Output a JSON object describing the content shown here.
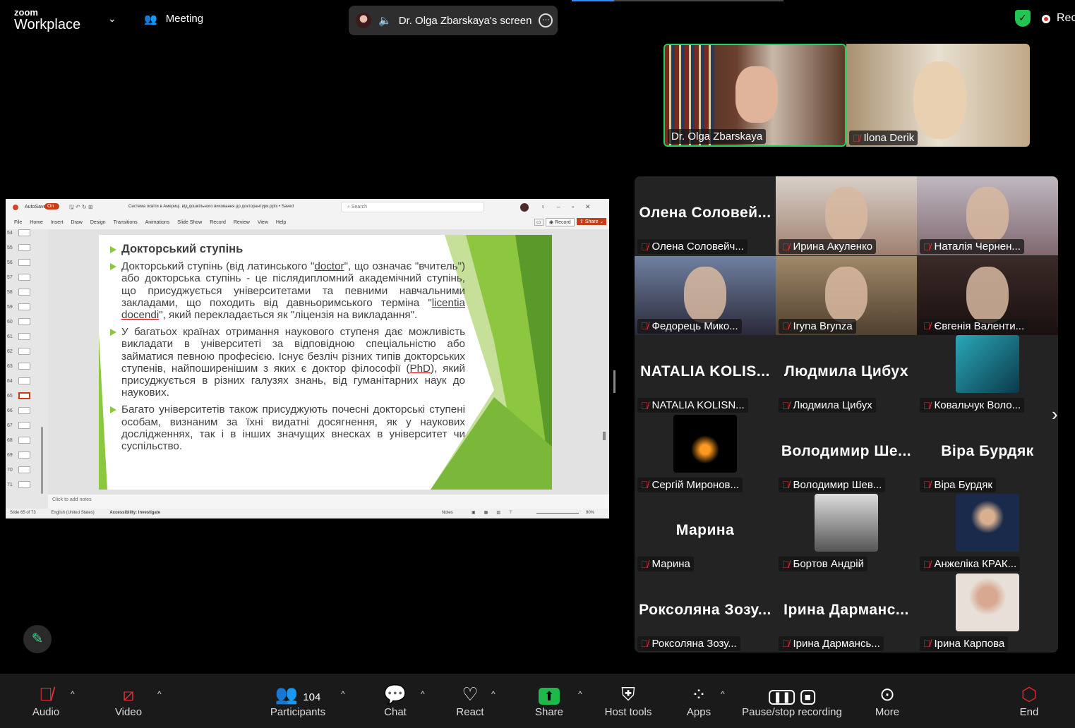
{
  "header": {
    "logo_top": "zoom",
    "logo_bottom": "Workplace",
    "meeting_label": "Meeting",
    "screen_label": "Dr. Olga Zbarskaya's screen",
    "recording_label": "Rec"
  },
  "powerpoint": {
    "autosave": "AutoSave",
    "toggle": "On",
    "file_title": "Система освіти в Америці. від дошкільного виховання до докторантури.pptx • Saved",
    "search_placeholder": "Search",
    "menu": [
      "File",
      "Home",
      "Insert",
      "Draw",
      "Design",
      "Transitions",
      "Animations",
      "Slide Show",
      "Record",
      "Review",
      "View",
      "Help"
    ],
    "record_btn": "Record",
    "share_btn": "Share",
    "thumb_numbers": [
      "54",
      "55",
      "56",
      "57",
      "58",
      "59",
      "60",
      "61",
      "62",
      "63",
      "64",
      "65",
      "66",
      "67",
      "68",
      "69",
      "70",
      "71"
    ],
    "notes_placeholder": "Click to add notes",
    "slide_counter": "Slide 65 of 73",
    "language": "English (United States)",
    "accessibility": "Accessibility: Investigate",
    "notes_btn": "Notes",
    "zoom_pct": "90%"
  },
  "slide": {
    "heading": "Докторський ступінь",
    "p1a": "Докторський ступінь (від латинського \"",
    "p1b": "doctor",
    "p1c": "\", що означає \"вчитель\") або докторська ступінь - це післядипломний академічний ступінь, що присуджується університетами та певними навчальними закладами, що походить від давньоримського терміна \"",
    "p1d": "licentia",
    "p1e": " ",
    "p1f": "docendi",
    "p1g": "\", який перекладається як \"ліцензія на викладання\".",
    "p2a": "У багатьох країнах отримання наукового ступеня дає можливість викладати в університеті за відповідною спеціальністю або займатися певною професією. Існує безліч різних типів докторських ступенів, найпоширенішим з яких є доктор філософії (",
    "p2b": "PhD",
    "p2c": "), який присуджується в різних галузях знань, від гуманітарних наук до наукових.",
    "p3": "Багато університетів також присуджують почесні докторські ступені особам, визнаним за їхні видатні досягнення, як у наукових дослідженнях, так і в інших значущих внесках в університет чи суспільство."
  },
  "spotlight": [
    {
      "name": "Dr. Olga Zbarskaya"
    },
    {
      "name": "Ilona Derik"
    }
  ],
  "gallery": [
    {
      "big": "Олена Соловей...",
      "name": "Олена Соловейч..."
    },
    {
      "name": "Ирина Акуленко"
    },
    {
      "name": "Наталія Чернен..."
    },
    {
      "name": "Федорець Мико..."
    },
    {
      "name": "Iryna Brynza"
    },
    {
      "name": "Євгенія Валенти..."
    },
    {
      "big": "NATALIA KOLIS...",
      "name": "NATALIA KOLISN..."
    },
    {
      "big": "Людмила Цибух",
      "name": "Людмила Цибух"
    },
    {
      "name": "Ковальчук Воло..."
    },
    {
      "name": "Сергій Миронов..."
    },
    {
      "big": "Володимир Ше...",
      "name": "Володимир Шев..."
    },
    {
      "big": "Віра Бурдяк",
      "name": "Віра Бурдяк"
    },
    {
      "big": "Марина",
      "name": "Марина"
    },
    {
      "name": "Бортов Андрій"
    },
    {
      "name": "Анжеліка КРАК..."
    },
    {
      "big": "Роксоляна Зозу...",
      "name": "Роксоляна Зозу..."
    },
    {
      "big": "Ірина Дарманс...",
      "name": "Ірина Дармансь..."
    },
    {
      "name": "Ірина Карпова"
    }
  ],
  "toolbar": {
    "audio": "Audio",
    "video": "Video",
    "participants": "Participants",
    "participants_count": "104",
    "chat": "Chat",
    "react": "React",
    "share": "Share",
    "host_tools": "Host tools",
    "apps": "Apps",
    "record": "Pause/stop recording",
    "more": "More",
    "end": "End"
  },
  "colors": {
    "share_green": "#1fb84a",
    "end_red": "#e02828",
    "active_speaker": "#23d160",
    "slide_green": "#8dc63f"
  }
}
